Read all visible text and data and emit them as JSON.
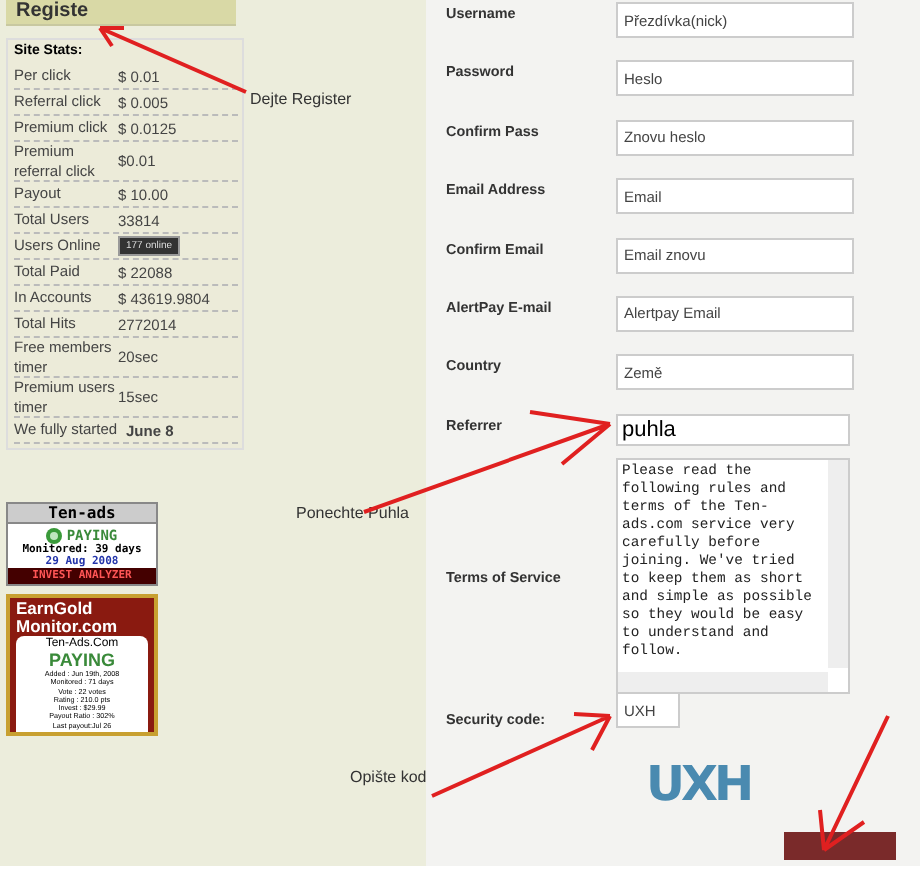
{
  "register_button": {
    "label": "Registe"
  },
  "site_stats": {
    "title": "Site Stats:",
    "rows": [
      {
        "label": "Per click",
        "value": "$ 0.01",
        "kind": "text"
      },
      {
        "label": "Referral click",
        "value": "$ 0.005",
        "kind": "text"
      },
      {
        "label": "Premium click",
        "value": "$ 0.0125",
        "kind": "text"
      },
      {
        "label": "Premium referral click",
        "value": "$0.01",
        "kind": "text"
      },
      {
        "label": "Payout",
        "value": "$ 10.00",
        "kind": "text"
      },
      {
        "label": "Total Users",
        "value": "33814",
        "kind": "text"
      },
      {
        "label": "Users Online",
        "value": "177 online",
        "kind": "badge"
      },
      {
        "label": "Total Paid",
        "value": "$ 22088",
        "kind": "text"
      },
      {
        "label": "In Accounts",
        "value": "$ 43619.9804",
        "kind": "text"
      },
      {
        "label": "Total Hits",
        "value": "2772014",
        "kind": "text"
      },
      {
        "label": "Free members timer",
        "value": "20sec",
        "kind": "text"
      },
      {
        "label": "Premium users timer",
        "value": "15sec",
        "kind": "text"
      },
      {
        "label": "We fully started",
        "value": "June 8",
        "kind": "bold"
      }
    ]
  },
  "monitor_badge": {
    "title": "Ten-ads",
    "status": "PAYING",
    "monitored": "Monitored: 39 days",
    "date": "29 Aug 2008",
    "footer": "INVEST ANALYZER"
  },
  "earngold_badge": {
    "logo_lines": [
      "EarnGold",
      "Monitor.com"
    ],
    "site": "Ten-Ads.Com",
    "status": "PAYING",
    "details": [
      "Added : Jun 19th, 2008",
      "Monitored : 71 days",
      "Vote : 22 votes",
      "Rating : 210.0 pts",
      "Invest : $29.99",
      "Payout Ratio : 302%",
      "Last payout:Jul 26"
    ]
  },
  "form": {
    "fields": [
      {
        "label": "Username",
        "value": "Přezdívka(nick)",
        "kind": "input"
      },
      {
        "label": "Password",
        "value": "Heslo",
        "kind": "input"
      },
      {
        "label": "Confirm Pass",
        "value": "Znovu heslo",
        "kind": "input"
      },
      {
        "label": "Email Address",
        "value": "Email",
        "kind": "input"
      },
      {
        "label": "Confirm Email",
        "value": "Email znovu",
        "kind": "input"
      },
      {
        "label": "AlertPay E-mail",
        "value": "Alertpay Email",
        "kind": "input"
      },
      {
        "label": "Country",
        "value": "Země",
        "kind": "input"
      },
      {
        "label": "Referrer",
        "value": "puhla",
        "kind": "emphasis"
      }
    ],
    "terms": {
      "label": "Terms of Service",
      "text": "Please read the following rules and terms of the Ten-ads.com service very carefully before joining. We've tried to keep them as short and simple as possible so they would be easy to understand and follow."
    },
    "security": {
      "label": "Security code:",
      "value": "UXH"
    },
    "captcha": "UXH"
  },
  "annotations": [
    "Dejte Register",
    "Ponechte Puhla",
    "Opište kod"
  ]
}
